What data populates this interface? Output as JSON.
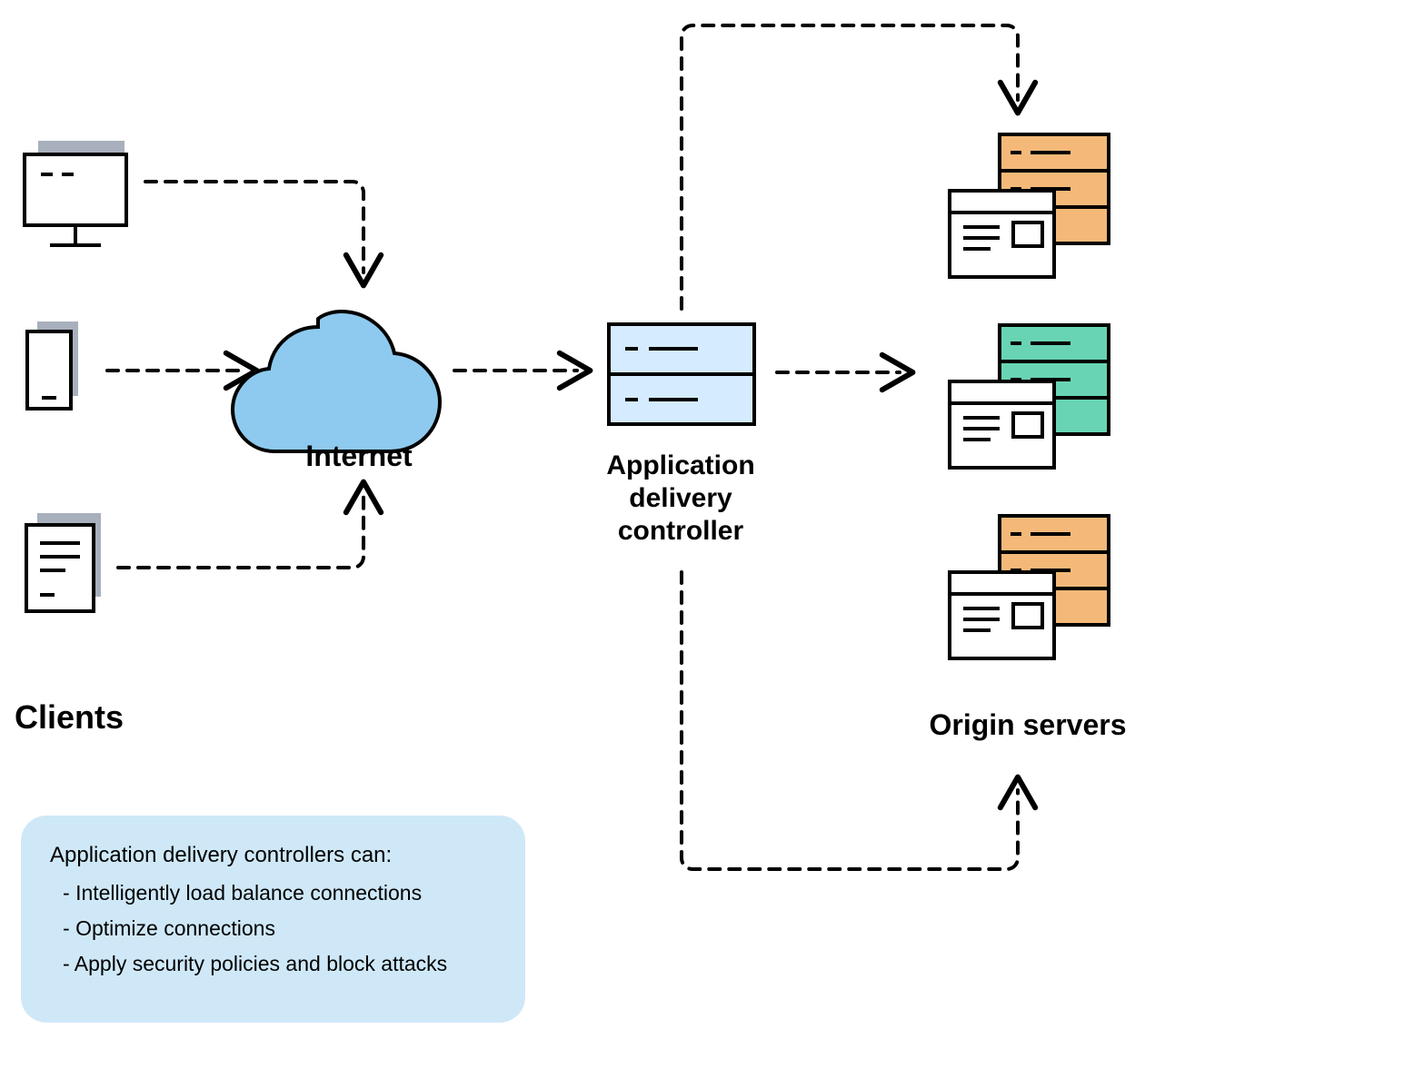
{
  "labels": {
    "internet": "Internet",
    "adc_line1": "Application",
    "adc_line2": "delivery",
    "adc_line3": "controller",
    "clients": "Clients",
    "origin_servers": "Origin servers"
  },
  "info": {
    "title": "Application delivery controllers can:",
    "items": [
      "Intelligently load balance connections",
      "Optimize connections",
      "Apply security policies and block attacks"
    ]
  },
  "colors": {
    "cloud": "#8ecaef",
    "adc_fill": "#d5ebff",
    "client_fill": "#a8b0bd",
    "server_orange": "#f4b978",
    "server_green": "#68d4b4",
    "info_bg": "#cfe8f7"
  }
}
